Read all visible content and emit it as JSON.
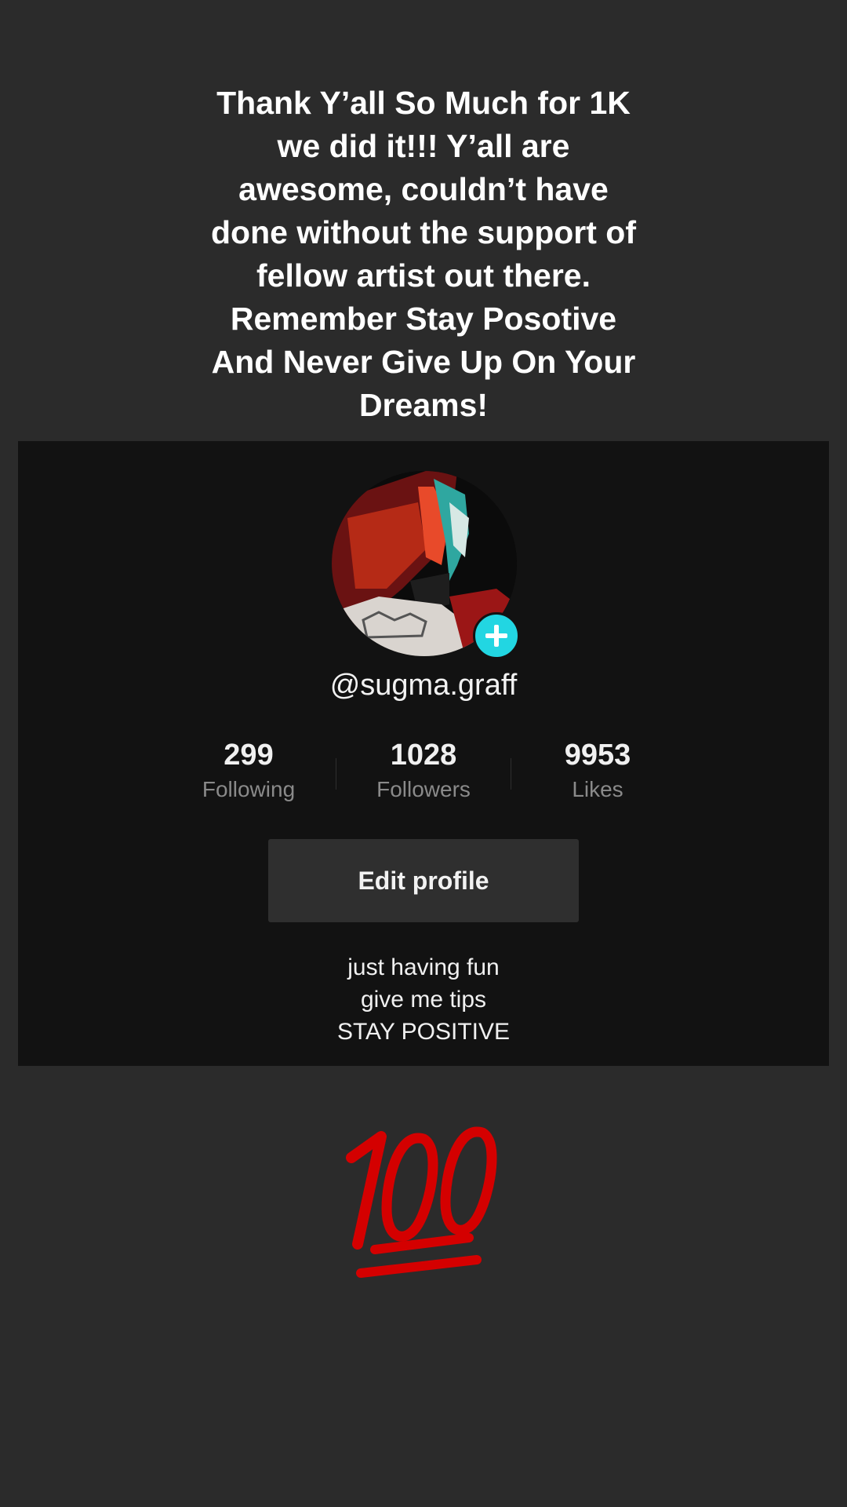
{
  "caption": {
    "lines": [
      "Thank Y’all So Much for 1K",
      "we did it!!! Y’all are",
      "awesome, couldn’t have",
      "done without the support of",
      "fellow artist out there.",
      "Remember Stay Posotive",
      "And Never Give Up On Your",
      "Dreams!"
    ]
  },
  "profile": {
    "avatar_icon": "profile-photo",
    "add_icon": "plus-icon",
    "username": "@sugma.graff",
    "stats": [
      {
        "value": "299",
        "label": "Following"
      },
      {
        "value": "1028",
        "label": "Followers"
      },
      {
        "value": "9953",
        "label": "Likes"
      }
    ],
    "edit_button": "Edit profile",
    "bio": [
      "just having fun",
      "give me tips",
      "STAY POSITIVE"
    ]
  },
  "sticker": {
    "icon": "hundred-points-icon",
    "color": "#d40000"
  },
  "colors": {
    "background": "#2b2b2b",
    "card": "#121212",
    "accent": "#22d6e2"
  }
}
